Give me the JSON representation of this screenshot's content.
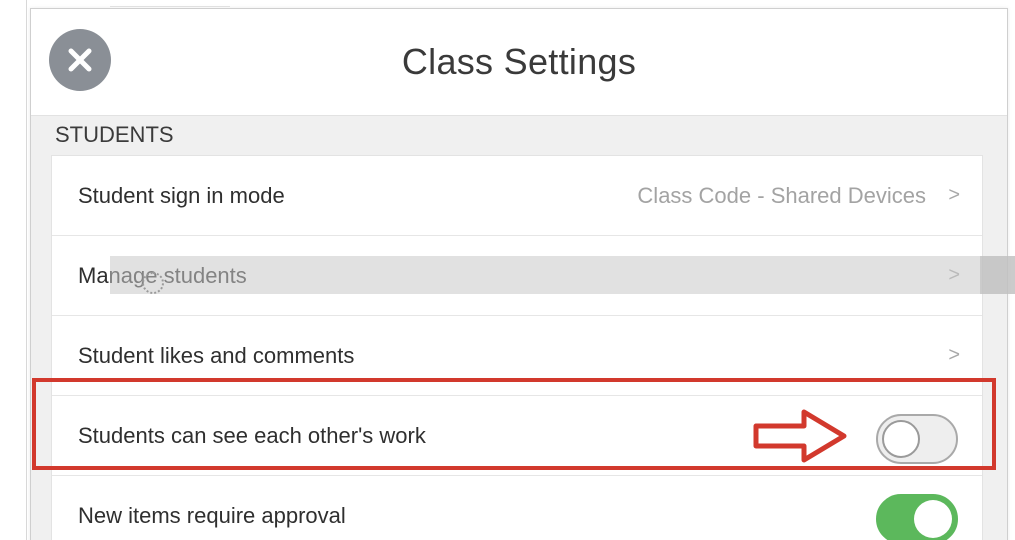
{
  "modal": {
    "title": "Class Settings",
    "close_icon": "close-icon"
  },
  "section": {
    "label": "STUDENTS"
  },
  "rows": [
    {
      "label": "Student sign in mode",
      "value": "Class Code - Shared Devices",
      "chevron": ">"
    },
    {
      "label": "Manage students",
      "chevron": ">"
    },
    {
      "label": "Student likes and comments",
      "chevron": ">"
    },
    {
      "label": "Students can see each other's work",
      "toggle": "off"
    },
    {
      "label": "New items require approval",
      "toggle": "on"
    }
  ],
  "colors": {
    "toggle_on": "#5cb85c",
    "highlight": "#d2392d",
    "close_button": "#8a8f96"
  }
}
